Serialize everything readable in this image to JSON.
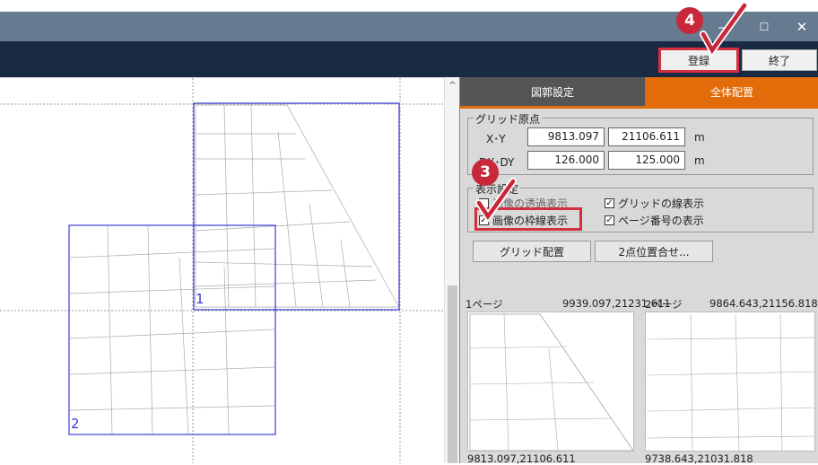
{
  "window": {
    "minimize": "—",
    "maximize": "☐",
    "close": "✕"
  },
  "toolbar": {
    "register": "登録",
    "end": "終了"
  },
  "canvas": {
    "page1_num": "1",
    "page2_num": "2"
  },
  "tabs": {
    "drawing_settings": "図郭設定",
    "overall_layout": "全体配置"
  },
  "grid_origin": {
    "title": "グリッド原点",
    "xy_label": "X･Y",
    "x_value": "9813.097",
    "y_value": "21106.611",
    "xy_unit": "m",
    "dxdy_label": "DX･DY",
    "dx_value": "126.000",
    "dy_value": "125.000",
    "dxdy_unit": "m"
  },
  "display_settings": {
    "title": "表示設定",
    "image_transparent": "画像の透過表示",
    "image_frame": "画像の枠線表示",
    "grid_lines": "グリッドの線表示",
    "page_number": "ページ番号の表示"
  },
  "buttons": {
    "grid_layout": "グリッド配置",
    "two_point_align": "2点位置合せ..."
  },
  "thumbnails": [
    {
      "header": "1ページ",
      "coords": "9939.097,21231.611",
      "footer": "9813.097,21106.611"
    },
    {
      "header": "2ページ",
      "coords": "9864.643,21156.818",
      "footer": "9738.643,21031.818"
    }
  ],
  "badges": {
    "step3": "3",
    "step4": "4"
  },
  "colors": {
    "accent": "#e36c0a",
    "toolbar": "#1a2a44",
    "frame": "#3b3bd4",
    "badge": "#c8283a"
  }
}
